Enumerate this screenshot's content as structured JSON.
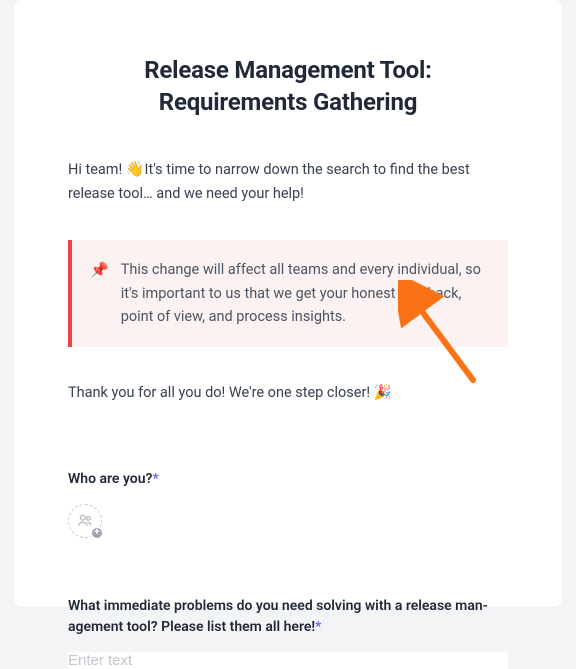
{
  "title_line1": "Release Management Tool:",
  "title_line2": "Requirements Gathering",
  "intro_prefix": "Hi team! ",
  "intro_wave": "👋",
  "intro_rest": "It's time to narrow down the search to find the best release tool… and we need your help!",
  "callout_pin": "📌",
  "callout_text": "This change will affect all teams and every individual, so it's important to us that we get your honest feedback, point of view, and process insights.",
  "thankyou_text": "Thank you for all you do! We're one step closer! ",
  "thankyou_emoji": "🎉",
  "q1_label": "Who are you?",
  "q2_label": "What immediate problems do you need solving with a release man­agement tool? Please list them all here!",
  "required_marker": "*",
  "text_placeholder": "Enter text",
  "colors": {
    "accent_red": "#ef4444",
    "required_blue": "#6366f1",
    "arrow": "#f97316"
  }
}
